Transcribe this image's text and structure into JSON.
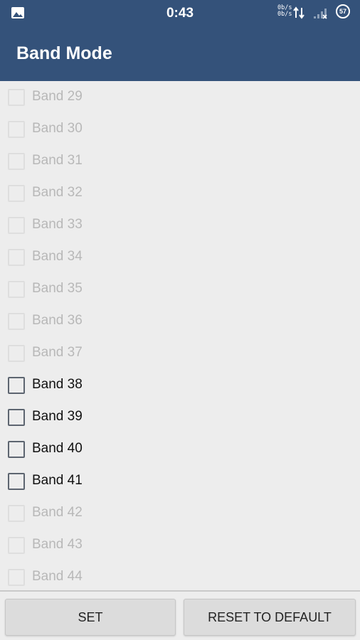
{
  "status_bar": {
    "time": "0:43",
    "net_up": "0b/s",
    "net_down": "0b/s",
    "battery": "57",
    "icons": [
      "gallery-icon",
      "data-arrows-icon",
      "signal-icon",
      "battery-icon"
    ]
  },
  "app_bar": {
    "title": "Band Mode"
  },
  "bands": [
    {
      "label": "Band 29",
      "enabled": false,
      "checked": false
    },
    {
      "label": "Band 30",
      "enabled": false,
      "checked": false
    },
    {
      "label": "Band 31",
      "enabled": false,
      "checked": false
    },
    {
      "label": "Band 32",
      "enabled": false,
      "checked": false
    },
    {
      "label": "Band 33",
      "enabled": false,
      "checked": false
    },
    {
      "label": "Band 34",
      "enabled": false,
      "checked": false
    },
    {
      "label": "Band 35",
      "enabled": false,
      "checked": false
    },
    {
      "label": "Band 36",
      "enabled": false,
      "checked": false
    },
    {
      "label": "Band 37",
      "enabled": false,
      "checked": false
    },
    {
      "label": "Band 38",
      "enabled": true,
      "checked": false
    },
    {
      "label": "Band 39",
      "enabled": true,
      "checked": false
    },
    {
      "label": "Band 40",
      "enabled": true,
      "checked": false
    },
    {
      "label": "Band 41",
      "enabled": true,
      "checked": false
    },
    {
      "label": "Band 42",
      "enabled": false,
      "checked": false
    },
    {
      "label": "Band 43",
      "enabled": false,
      "checked": false
    },
    {
      "label": "Band 44",
      "enabled": false,
      "checked": false
    }
  ],
  "buttons": {
    "set": "SET",
    "reset": "RESET TO DEFAULT"
  },
  "colors": {
    "app_bar": "#34527a",
    "background": "#ededed",
    "disabled_text": "#b8b8b8"
  }
}
